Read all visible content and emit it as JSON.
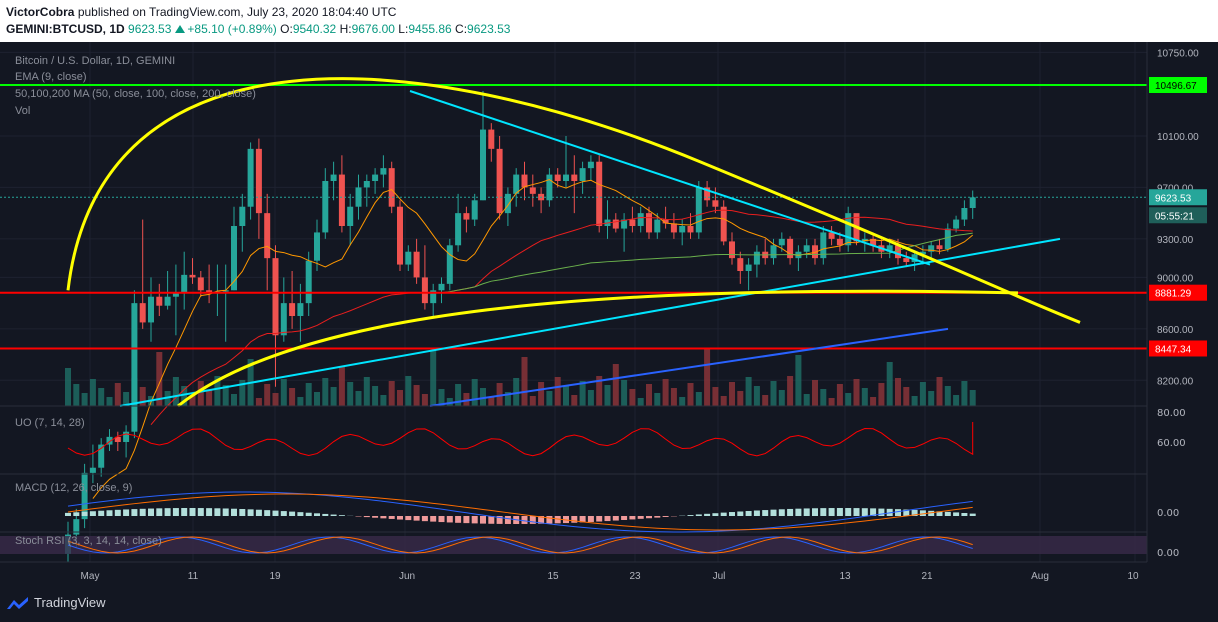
{
  "header": {
    "author": "VictorCobra",
    "published": "published on TradingView.com, July 23, 2020 18:04:40 UTC",
    "symbol": "GEMINI:BTCUSD, 1D",
    "last": "9623.53",
    "change": "+85.10 (+0.89%)",
    "o_label": "O:",
    "o": "9540.32",
    "h_label": "H:",
    "h": "9676.00",
    "l_label": "L:",
    "l": "9455.86",
    "c_label": "C:",
    "c": "9623.53"
  },
  "legend": {
    "title": "Bitcoin / U.S. Dollar, 1D, GEMINI",
    "ema": "EMA (9, close)",
    "ma": "50,100,200 MA (50, close, 100, close, 200, close)",
    "vol": "Vol",
    "uo": "UO (7, 14, 28)",
    "macd": "MACD (12, 26, close, 9)",
    "stoch": "Stoch RSI (3, 3, 14, 14, close)"
  },
  "price_axis": {
    "ticks": [
      "10750.00",
      "10100.00",
      "9700.00",
      "9300.00",
      "9000.00",
      "8600.00",
      "8200.00"
    ],
    "labels": {
      "resistance": "10496.67",
      "last_price": "9623.53",
      "countdown": "05:55:21",
      "support1": "8881.29",
      "support2": "8447.34"
    }
  },
  "uo_axis": [
    "80.00",
    "60.00"
  ],
  "macd_axis": [
    "0.00"
  ],
  "stoch_axis": [
    "0.00"
  ],
  "time_axis": [
    "May",
    "11",
    "19",
    "Jun",
    "15",
    "23",
    "Jul",
    "13",
    "21",
    "Aug",
    "10"
  ],
  "footer": {
    "brand": "TradingView"
  },
  "colors": {
    "bull": "#26a69a",
    "bear": "#ef5350",
    "bg": "#131722",
    "green_line": "#00ff00",
    "red_line": "#ff0000",
    "yellow": "#ffff00",
    "cyan": "#00e5ff",
    "blue": "#2962ff",
    "ema": "#ff9800",
    "ma50": "#e91e1e",
    "ma100": "#6ab04c",
    "uo": "#ff0000",
    "last": "#26a69a",
    "axis_bg": "#131722"
  },
  "chart_data": {
    "type": "candlestick",
    "title": "Bitcoin / U.S. Dollar, 1D, GEMINI",
    "x_range": [
      "2020-04-21",
      "2020-07-23"
    ],
    "ylim": [
      8000,
      10800
    ],
    "levels": {
      "resistance": 10496.67,
      "support1": 8881.29,
      "support2": 8447.34,
      "last": 9623.53
    },
    "candles": [
      [
        6850,
        7100,
        6750,
        7000
      ],
      [
        7000,
        7200,
        6900,
        7120
      ],
      [
        7120,
        7550,
        7050,
        7480
      ],
      [
        7480,
        7700,
        7400,
        7520
      ],
      [
        7520,
        7750,
        7450,
        7700
      ],
      [
        7700,
        7820,
        7650,
        7760
      ],
      [
        7760,
        7800,
        7650,
        7720
      ],
      [
        7720,
        7850,
        7600,
        7800
      ],
      [
        7800,
        8900,
        7750,
        8800
      ],
      [
        8800,
        9450,
        8600,
        8650
      ],
      [
        8650,
        9000,
        8500,
        8850
      ],
      [
        8850,
        8950,
        8700,
        8780
      ],
      [
        8780,
        9050,
        8750,
        8850
      ],
      [
        8850,
        9100,
        8550,
        8880
      ],
      [
        8880,
        9200,
        8750,
        9020
      ],
      [
        9020,
        9150,
        8950,
        9000
      ],
      [
        9000,
        9050,
        8850,
        8900
      ],
      [
        8900,
        9100,
        8800,
        8880
      ],
      [
        8880,
        9100,
        8700,
        8890
      ],
      [
        8890,
        9100,
        8500,
        8900
      ],
      [
        8900,
        9550,
        8900,
        9400
      ],
      [
        9400,
        9650,
        9200,
        9550
      ],
      [
        9550,
        10050,
        9450,
        10000
      ],
      [
        10000,
        10080,
        9300,
        9500
      ],
      [
        9500,
        9650,
        8900,
        9150
      ],
      [
        9150,
        9250,
        8150,
        8550
      ],
      [
        8550,
        9000,
        8500,
        8800
      ],
      [
        8800,
        9050,
        8600,
        8700
      ],
      [
        8700,
        8950,
        8500,
        8800
      ],
      [
        8800,
        9200,
        8700,
        9130
      ],
      [
        9130,
        9450,
        9050,
        9350
      ],
      [
        9350,
        9850,
        9300,
        9750
      ],
      [
        9750,
        9900,
        9600,
        9800
      ],
      [
        9800,
        9950,
        9350,
        9400
      ],
      [
        9400,
        9650,
        9250,
        9550
      ],
      [
        9550,
        9800,
        9450,
        9700
      ],
      [
        9700,
        9800,
        9550,
        9750
      ],
      [
        9750,
        9850,
        9650,
        9800
      ],
      [
        9800,
        9950,
        9700,
        9850
      ],
      [
        9850,
        9900,
        9500,
        9550
      ],
      [
        9550,
        9600,
        9050,
        9100
      ],
      [
        9100,
        9250,
        9050,
        9200
      ],
      [
        9200,
        9300,
        8950,
        9000
      ],
      [
        9000,
        9250,
        8750,
        8800
      ],
      [
        8800,
        8950,
        8700,
        8900
      ],
      [
        8900,
        9000,
        8800,
        8950
      ],
      [
        8950,
        9300,
        8900,
        9250
      ],
      [
        9250,
        9650,
        9200,
        9500
      ],
      [
        9500,
        9550,
        9350,
        9450
      ],
      [
        9450,
        9650,
        9400,
        9600
      ],
      [
        9600,
        10450,
        9600,
        10150
      ],
      [
        10150,
        10200,
        9900,
        10000
      ],
      [
        10000,
        10100,
        9450,
        9500
      ],
      [
        9500,
        9700,
        9400,
        9650
      ],
      [
        9650,
        9850,
        9550,
        9800
      ],
      [
        9800,
        9900,
        9600,
        9700
      ],
      [
        9700,
        9800,
        9550,
        9650
      ],
      [
        9650,
        9700,
        9500,
        9600
      ],
      [
        9600,
        9850,
        9550,
        9800
      ],
      [
        9800,
        9850,
        9700,
        9750
      ],
      [
        9750,
        10100,
        9700,
        9800
      ],
      [
        9800,
        9950,
        9500,
        9750
      ],
      [
        9750,
        9900,
        9650,
        9850
      ],
      [
        9850,
        9950,
        9750,
        9900
      ],
      [
        9900,
        9950,
        9350,
        9400
      ],
      [
        9400,
        9600,
        9300,
        9450
      ],
      [
        9450,
        9500,
        9350,
        9380
      ],
      [
        9380,
        9500,
        9200,
        9450
      ],
      [
        9450,
        9550,
        9350,
        9400
      ],
      [
        9400,
        9550,
        9350,
        9500
      ],
      [
        9500,
        9550,
        9300,
        9350
      ],
      [
        9350,
        9500,
        9300,
        9450
      ],
      [
        9450,
        9550,
        9380,
        9420
      ],
      [
        9420,
        9500,
        9300,
        9350
      ],
      [
        9350,
        9450,
        9250,
        9400
      ],
      [
        9400,
        9500,
        9300,
        9350
      ],
      [
        9350,
        9750,
        9300,
        9700
      ],
      [
        9700,
        9750,
        9550,
        9600
      ],
      [
        9600,
        9700,
        9500,
        9550
      ],
      [
        9550,
        9600,
        9250,
        9280
      ],
      [
        9280,
        9350,
        9100,
        9150
      ],
      [
        9150,
        9200,
        8950,
        9050
      ],
      [
        9050,
        9150,
        8900,
        9100
      ],
      [
        9100,
        9250,
        9000,
        9200
      ],
      [
        9200,
        9300,
        9100,
        9150
      ],
      [
        9150,
        9300,
        9100,
        9250
      ],
      [
        9250,
        9350,
        9200,
        9300
      ],
      [
        9300,
        9320,
        9100,
        9150
      ],
      [
        9150,
        9250,
        9050,
        9200
      ],
      [
        9200,
        9300,
        9150,
        9250
      ],
      [
        9250,
        9300,
        9100,
        9150
      ],
      [
        9150,
        9400,
        9100,
        9350
      ],
      [
        9350,
        9400,
        9250,
        9300
      ],
      [
        9300,
        9350,
        9200,
        9250
      ],
      [
        9250,
        9550,
        9200,
        9500
      ],
      [
        9500,
        9450,
        9250,
        9280
      ],
      [
        9280,
        9350,
        9200,
        9300
      ],
      [
        9300,
        9350,
        9200,
        9250
      ],
      [
        9250,
        9300,
        9150,
        9200
      ],
      [
        9200,
        9300,
        9150,
        9250
      ],
      [
        9250,
        9300,
        9100,
        9150
      ],
      [
        9150,
        9200,
        9080,
        9120
      ],
      [
        9120,
        9200,
        9050,
        9180
      ],
      [
        9180,
        9250,
        9100,
        9200
      ],
      [
        9200,
        9280,
        9150,
        9250
      ],
      [
        9250,
        9300,
        9180,
        9220
      ],
      [
        9220,
        9420,
        9200,
        9380
      ],
      [
        9380,
        9480,
        9350,
        9450
      ],
      [
        9450,
        9600,
        9400,
        9540
      ],
      [
        9540,
        9676,
        9455,
        9623
      ]
    ]
  }
}
